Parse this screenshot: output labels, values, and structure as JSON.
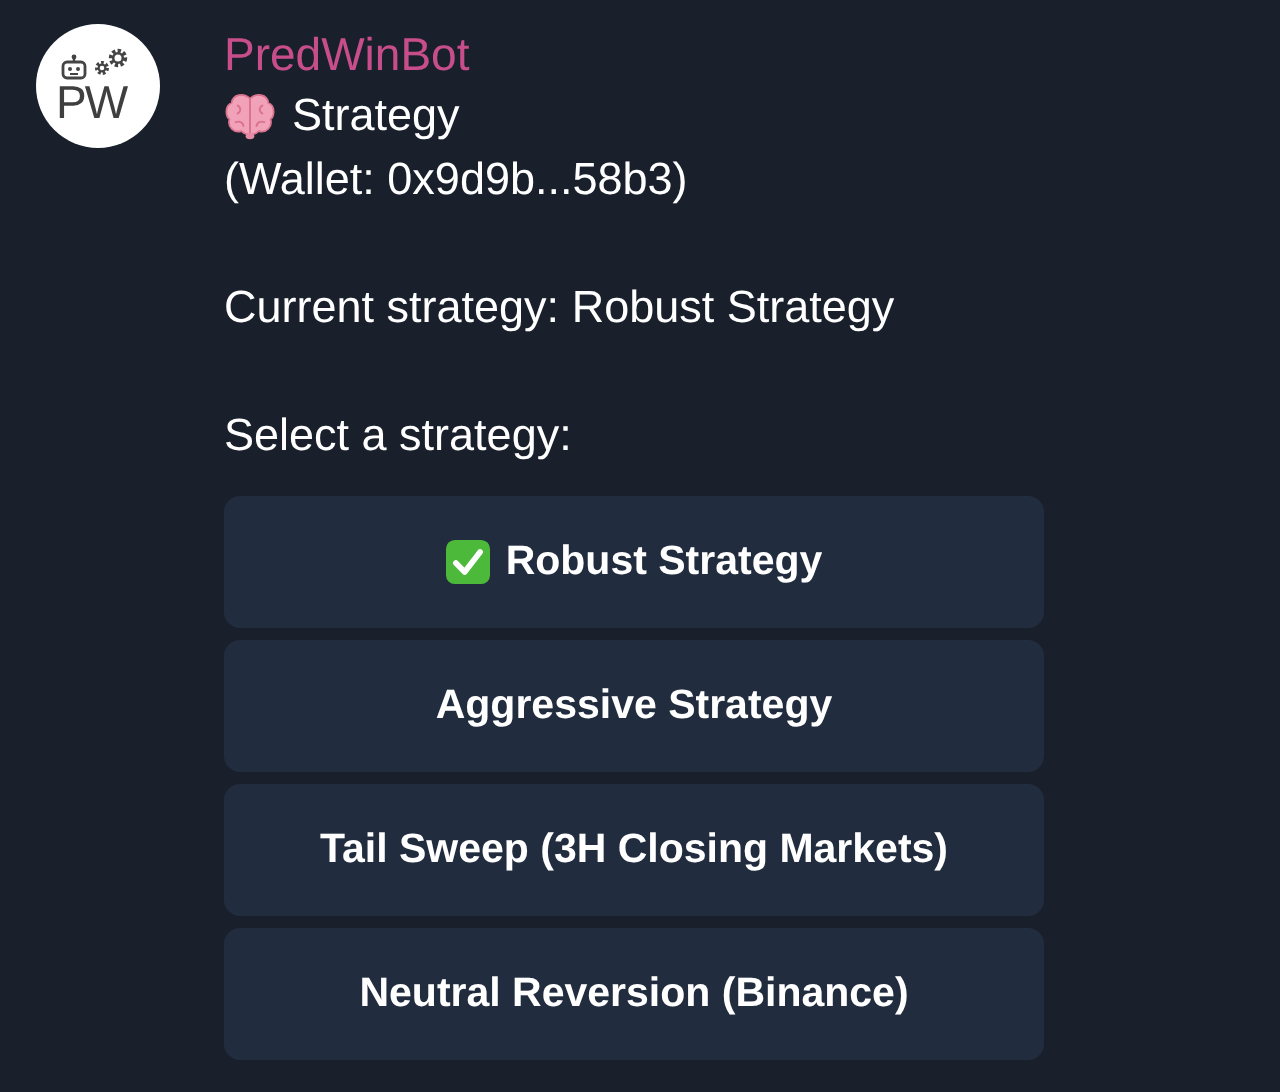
{
  "sender": {
    "name": "PredWinBot",
    "avatar_text": "PW"
  },
  "message": {
    "title": "Strategy",
    "wallet": "(Wallet: 0x9d9b...58b3)",
    "current": "Current strategy: Robust Strategy",
    "prompt": "Select a strategy:"
  },
  "buttons": [
    {
      "label": "Robust Strategy",
      "selected": true
    },
    {
      "label": "Aggressive Strategy",
      "selected": false
    },
    {
      "label": "Tail Sweep (3H Closing Markets)",
      "selected": false
    },
    {
      "label": "Neutral Reversion (Binance)",
      "selected": false
    }
  ]
}
